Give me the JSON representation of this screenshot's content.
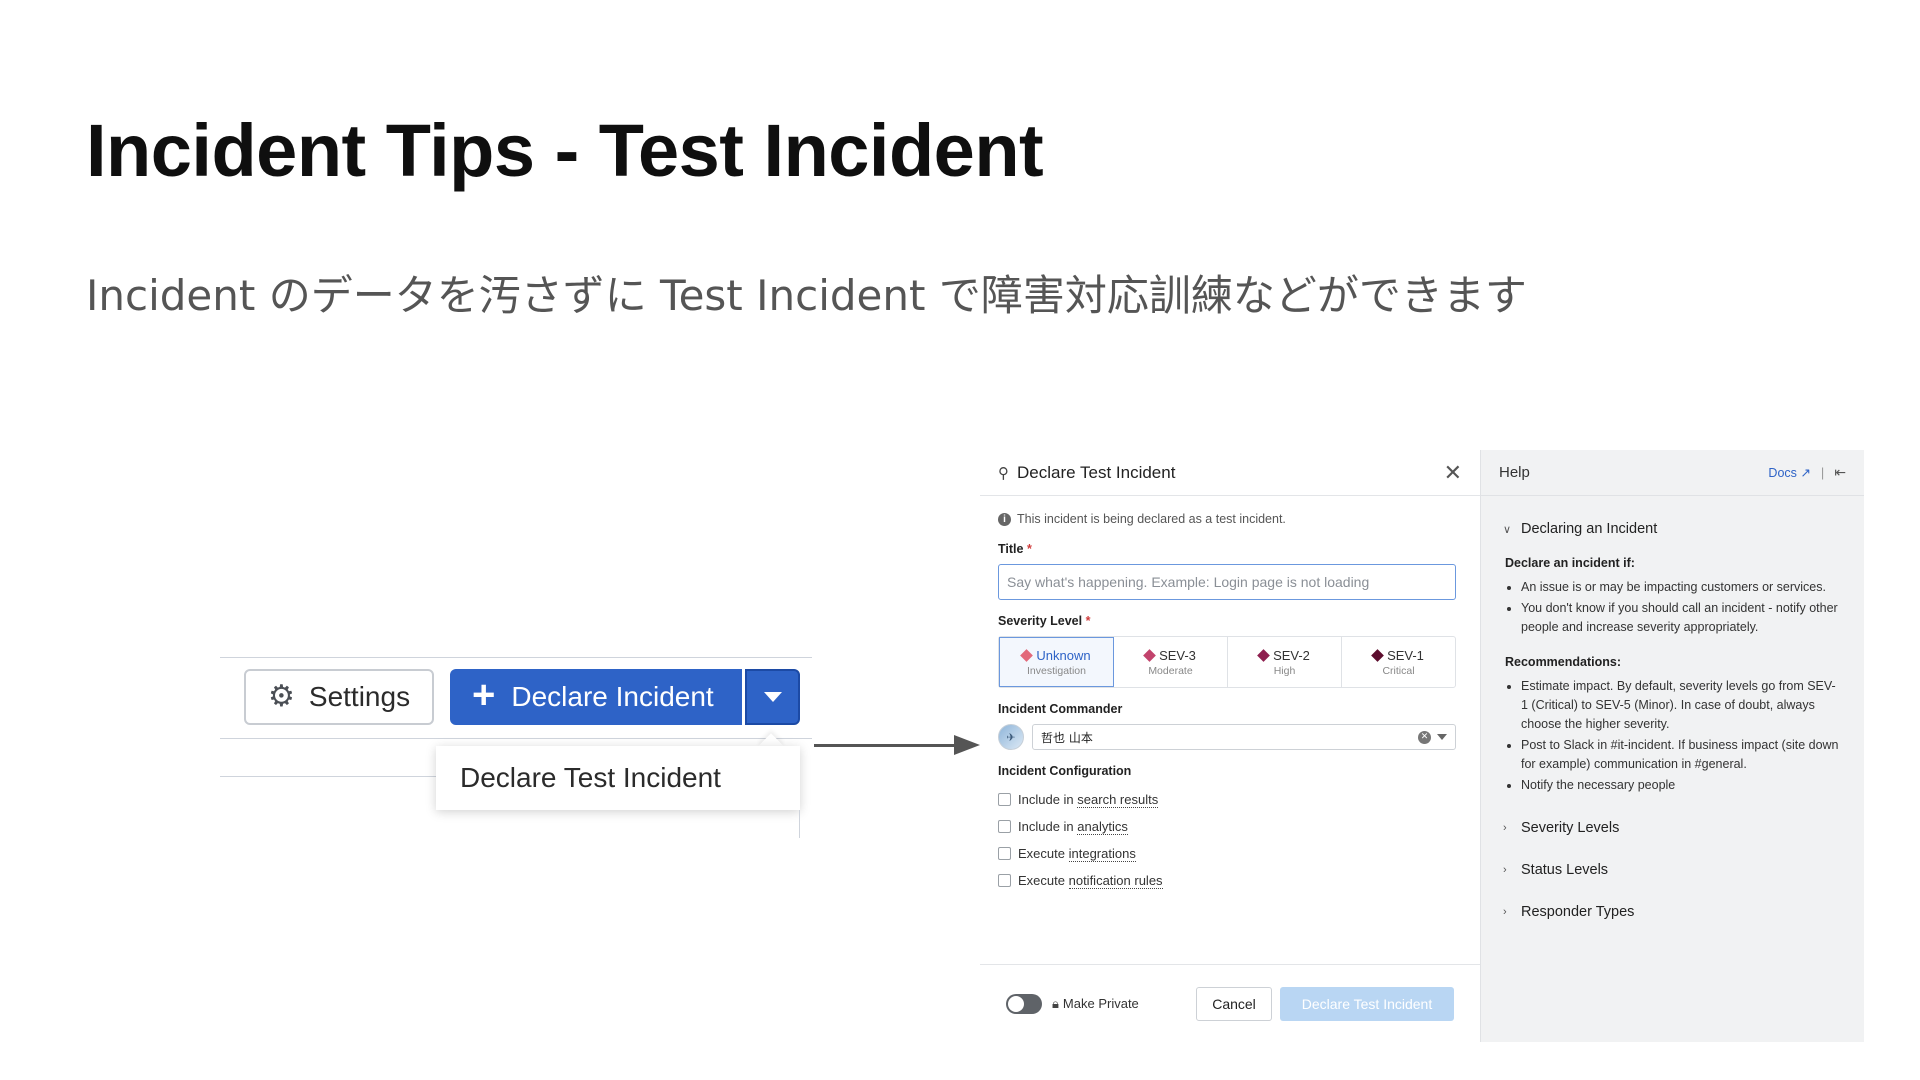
{
  "slide": {
    "title": "Incident Tips - Test Incident",
    "subtitle": "Incident のデータを汚さずに Test Incident で障害対応訓練などができます"
  },
  "toolbar": {
    "settings_label": "Settings",
    "declare_label": "Declare Incident",
    "dropdown_item": "Declare Test Incident"
  },
  "modal": {
    "title": "Declare Test Incident",
    "notice": "This incident is being declared as a test incident.",
    "title_label": "Title",
    "required_mark": "*",
    "title_placeholder": "Say what's happening. Example: Login page is not loading",
    "severity_label": "Severity Level",
    "severities": [
      {
        "name": "Unknown",
        "desc": "Investigation",
        "color": "#e2697a",
        "selected": true
      },
      {
        "name": "SEV-3",
        "desc": "Moderate",
        "color": "#c2436c"
      },
      {
        "name": "SEV-2",
        "desc": "High",
        "color": "#8e1f4f"
      },
      {
        "name": "SEV-1",
        "desc": "Critical",
        "color": "#5c0d2e"
      }
    ],
    "commander_label": "Incident Commander",
    "commander_value": "哲也 山本",
    "config_label": "Incident Configuration",
    "config_options": [
      {
        "prefix": "Include in",
        "link": "search results"
      },
      {
        "prefix": "Include in",
        "link": "analytics"
      },
      {
        "prefix": "Execute",
        "link": "integrations"
      },
      {
        "prefix": "Execute",
        "link": "notification rules"
      }
    ],
    "private_label": "Make Private",
    "cancel_label": "Cancel",
    "submit_label": "Declare Test Incident"
  },
  "help": {
    "title": "Help",
    "docs_label": "Docs",
    "section_title": "Declaring an Incident",
    "declare_if_label": "Declare an incident if:",
    "declare_if": [
      "An issue is or may be impacting customers or services.",
      "You don't know if you should call an incident - notify other people and increase severity appropriately."
    ],
    "recommendations_label": "Recommendations:",
    "recommendations": [
      "Estimate impact. By default, severity levels go from SEV-1 (Critical) to SEV-5 (Minor). In case of doubt, always choose the higher severity.",
      "Post to Slack in #it-incident. If business impact (site down for example) communication in #general.",
      "Notify the necessary people"
    ],
    "collapsed_sections": [
      "Severity Levels",
      "Status Levels",
      "Responder Types"
    ]
  },
  "colors": {
    "primary_button": "#2e63c7",
    "disabled_button": "#b9d6f3",
    "help_background": "#f1f2f3"
  },
  "icons": {
    "settings": "gear-icon",
    "declare": "plus-icon",
    "caret": "caret-down-icon",
    "close": "close-icon",
    "info": "info-icon",
    "lock": "lock-icon",
    "docs_link": "external-link-icon",
    "collapse": "collapse-panel-icon"
  }
}
